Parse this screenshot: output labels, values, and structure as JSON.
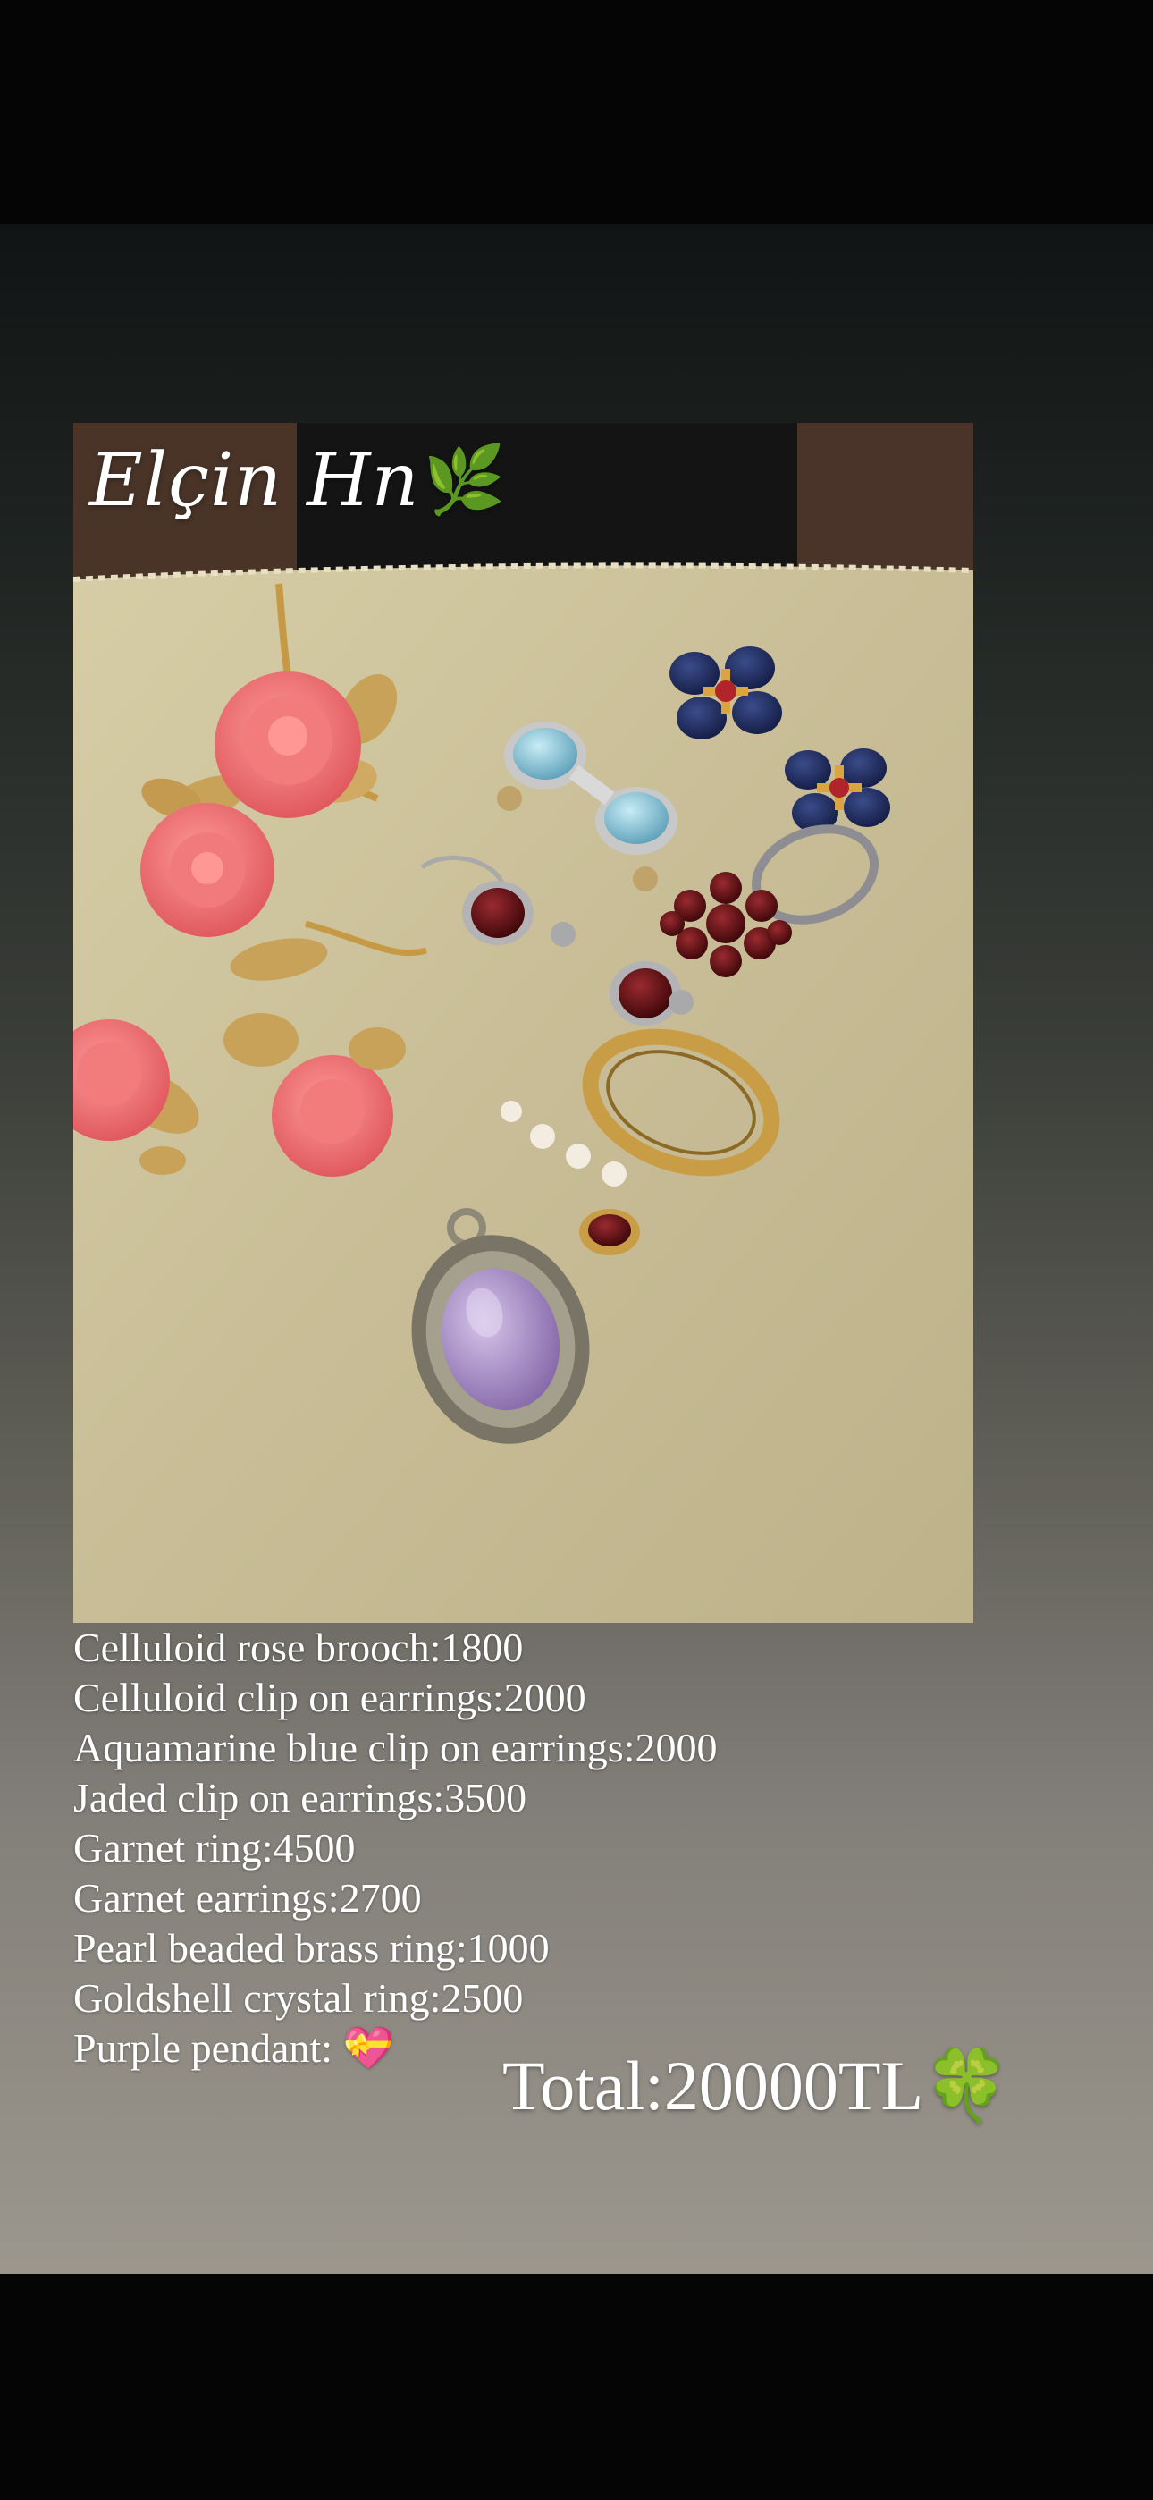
{
  "watermark": {
    "name": "Elçin Hn",
    "emoji": "🌿"
  },
  "items": [
    {
      "text": "Celluloid rose brooch:1800"
    },
    {
      "text": "Celluloid clip on earrings:2000"
    },
    {
      "text": "Aquamarine blue clip on earrings:2000"
    },
    {
      "text": "Jaded clip on earrings:3500"
    },
    {
      "text": "Garnet ring:4500"
    },
    {
      "text": "Garnet earrings:2700"
    },
    {
      "text": "Pearl beaded brass ring:1000"
    },
    {
      "text": "Goldshell crystal ring:2500"
    },
    {
      "text": "Purple pendant: 💝"
    }
  ],
  "total": "Total:20000TL🍀",
  "colors": {
    "cloth": "#c9bf98",
    "coral": "#f06f72",
    "gold": "#c9a24a",
    "lapis": "#1d2a5c",
    "garnet": "#5a0f14",
    "amethyst": "#a890c8",
    "aquamarine": "#8ac6dc"
  }
}
